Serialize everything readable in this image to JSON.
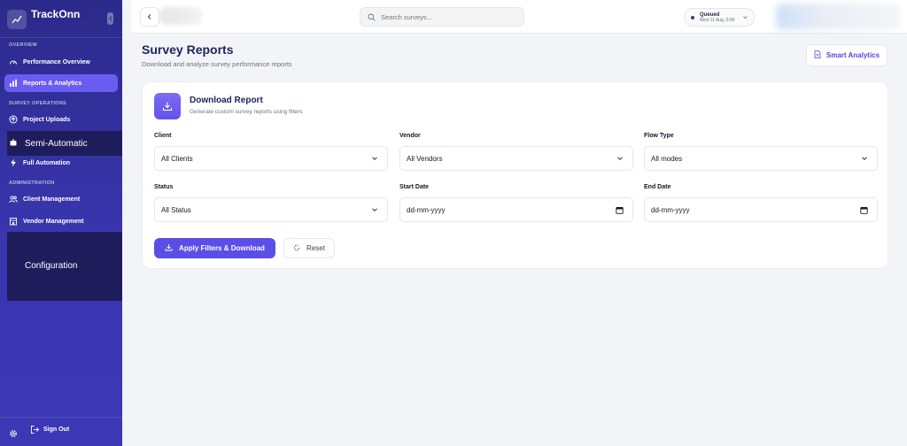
{
  "brand": {
    "name": "TrackOnn"
  },
  "sidebar": {
    "sections": [
      {
        "label": "OVERVIEW"
      },
      {
        "label": "SURVEY OPERATIONS"
      },
      {
        "label": "ADMINISTRATION"
      }
    ],
    "items": [
      {
        "label": "Performance Overview",
        "icon": "gauge-icon"
      },
      {
        "label": "Reports & Analytics",
        "icon": "bar-chart-icon",
        "active": true
      },
      {
        "label": "Project Uploads",
        "icon": "upload-icon"
      },
      {
        "label": "Semi-Automatic",
        "icon": "robot-icon"
      },
      {
        "label": "Full Automation",
        "icon": "lightning-icon"
      },
      {
        "label": "Client Management",
        "icon": "users-icon"
      },
      {
        "label": "Vendor Management",
        "icon": "building-icon"
      },
      {
        "label": "Configuration",
        "icon": "gear-icon"
      }
    ],
    "sign_out": "Sign Out"
  },
  "topbar": {
    "search_placeholder": "Search surveys...",
    "queue": {
      "title": "Queued",
      "subtitle": "Next 11 Aug, 0:00"
    }
  },
  "page": {
    "title": "Survey Reports",
    "subtitle": "Download and analyze survey performance reports",
    "smart_analytics": "Smart Analytics"
  },
  "card": {
    "title": "Download Report",
    "subtitle": "Generate custom survey reports using filters",
    "fields": [
      {
        "label": "Client",
        "value": "All Clients",
        "kind": "select"
      },
      {
        "label": "Vendor",
        "value": "All Vendors",
        "kind": "select"
      },
      {
        "label": "Flow Type",
        "value": "All modes",
        "kind": "select"
      },
      {
        "label": "Status",
        "value": "All Status",
        "kind": "select"
      },
      {
        "label": "Start Date",
        "value": "dd-mm-yyyy",
        "kind": "date"
      },
      {
        "label": "End Date",
        "value": "dd-mm-yyyy",
        "kind": "date"
      }
    ],
    "apply_label": "Apply Filters & Download",
    "reset_label": "Reset"
  },
  "colors": {
    "accent": "#5b4ee6",
    "sidebar": "#3a36b0",
    "title": "#1f2560"
  }
}
